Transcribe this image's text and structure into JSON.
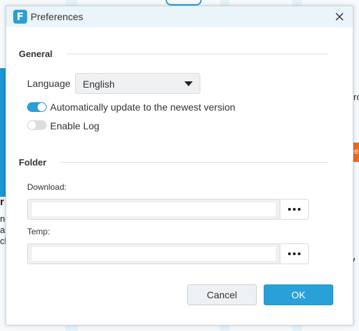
{
  "background": {
    "fragments": [
      "ro",
      "ee",
      "r",
      "nd",
      "a",
      "ck",
      "y"
    ]
  },
  "dialog": {
    "title": "Preferences",
    "logo_letter": "F",
    "accent_color": "#2aa0d8",
    "general": {
      "heading": "General",
      "language_label": "Language",
      "language_value": "English",
      "auto_update": {
        "label": "Automatically update to the newest version",
        "enabled": true
      },
      "enable_log": {
        "label": "Enable Log",
        "enabled": false
      }
    },
    "folder": {
      "heading": "Folder",
      "download_label": "Download:",
      "download_value": "",
      "temp_label": "Temp:",
      "temp_value": "",
      "browse_icon": "more-dots-icon"
    },
    "buttons": {
      "cancel": "Cancel",
      "ok": "OK"
    }
  }
}
